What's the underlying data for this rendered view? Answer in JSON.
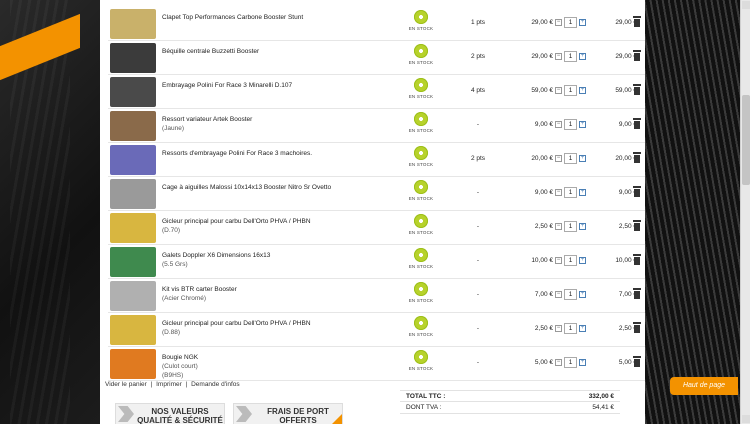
{
  "cart": {
    "rows": [
      {
        "name": "Clapet Top Performances Carbone Booster Stunt",
        "sub": "",
        "stock": "EN STOCK",
        "pts": "1 pts",
        "price": "29,00 €",
        "qty": "1",
        "total": "29,00 €",
        "thumb_color": "#c9b16a"
      },
      {
        "name": "Béquille centrale Buzzetti Booster",
        "sub": "",
        "stock": "EN STOCK",
        "pts": "2 pts",
        "price": "29,00 €",
        "qty": "1",
        "total": "29,00 €",
        "thumb_color": "#3b3b3b"
      },
      {
        "name": "Embrayage Polini For Race 3 Minarelli D.107",
        "sub": "",
        "stock": "EN STOCK",
        "pts": "4 pts",
        "price": "59,00 €",
        "qty": "1",
        "total": "59,00 €",
        "thumb_color": "#4a4a4a"
      },
      {
        "name": "Ressort variateur Artek Booster",
        "sub": "(Jaune)",
        "stock": "EN STOCK",
        "pts": "-",
        "price": "9,00 €",
        "qty": "1",
        "total": "9,00 €",
        "thumb_color": "#8a6a4a"
      },
      {
        "name": "Ressorts d'embrayage Polini For Race 3 machoires.",
        "sub": "",
        "stock": "EN STOCK",
        "pts": "2 pts",
        "price": "20,00 €",
        "qty": "1",
        "total": "20,00 €",
        "thumb_color": "#6a6ab8"
      },
      {
        "name": "Cage à aiguilles Malossi 10x14x13 Booster Nitro Sr Ovetto",
        "sub": "",
        "stock": "EN STOCK",
        "pts": "-",
        "price": "9,00 €",
        "qty": "1",
        "total": "9,00 €",
        "thumb_color": "#9a9a9a"
      },
      {
        "name": "Gicleur principal pour carbu Dell'Orto PHVA / PHBN",
        "sub": "(D.70)",
        "stock": "EN STOCK",
        "pts": "-",
        "price": "2,50 €",
        "qty": "1",
        "total": "2,50 €",
        "thumb_color": "#d8b640"
      },
      {
        "name": "Galets Doppler X6 Dimensions 16x13",
        "sub": "(5.5 Grs)",
        "stock": "EN STOCK",
        "pts": "-",
        "price": "10,00 €",
        "qty": "1",
        "total": "10,00 €",
        "thumb_color": "#3f8a4e"
      },
      {
        "name": "Kit vis BTR carter Booster",
        "sub": "(Acier Chromé)",
        "stock": "EN STOCK",
        "pts": "-",
        "price": "7,00 €",
        "qty": "1",
        "total": "7,00 €",
        "thumb_color": "#b0b0b0"
      },
      {
        "name": "Gicleur principal pour carbu Dell'Orto PHVA / PHBN",
        "sub": "(D.88)",
        "stock": "EN STOCK",
        "pts": "-",
        "price": "2,50 €",
        "qty": "1",
        "total": "2,50 €",
        "thumb_color": "#d8b640"
      },
      {
        "name": "Bougie NGK",
        "sub": "(Culot court)",
        "sub2": "(B9HS)",
        "stock": "EN STOCK",
        "pts": "-",
        "price": "5,00 €",
        "qty": "1",
        "total": "5,00 €",
        "thumb_color": "#e07a20"
      }
    ]
  },
  "links": {
    "empty_cart": "Vider le panier",
    "print": "Imprimer",
    "info_request": "Demande d'infos",
    "separator": "|"
  },
  "totals": {
    "ttc_label": "TOTAL TTC :",
    "ttc_value": "332,00 €",
    "tva_label": "DONT TVA :",
    "tva_value": "54,41 €"
  },
  "banners": {
    "values": "NOS VALEURS QUALITÉ & SÉCURITÉ",
    "shipping": "FRAIS DE PORT OFFERTS"
  },
  "top_button": "Haut de page",
  "colors": {
    "accent": "#f39200",
    "stock_green": "#b7d22b"
  }
}
